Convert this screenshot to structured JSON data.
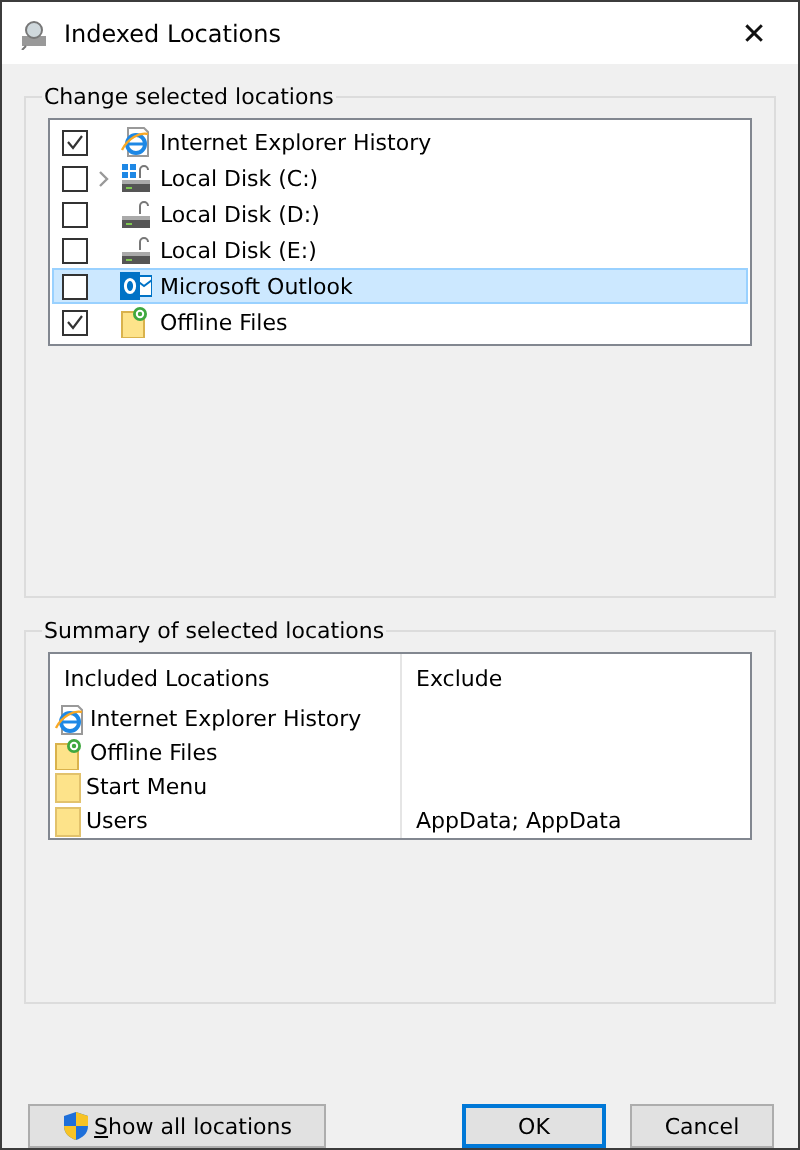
{
  "window": {
    "title": "Indexed Locations",
    "close": "✕"
  },
  "change_group": {
    "title": "Change selected locations",
    "items": [
      {
        "label": "Internet Explorer History",
        "kind": "ie",
        "checked": true,
        "expandable": false,
        "selected": false
      },
      {
        "label": "Local Disk (C:)",
        "kind": "system-disk",
        "checked": false,
        "expandable": true,
        "selected": false
      },
      {
        "label": "Local Disk (D:)",
        "kind": "disk",
        "checked": false,
        "expandable": false,
        "selected": false
      },
      {
        "label": "Local Disk (E:)",
        "kind": "disk",
        "checked": false,
        "expandable": false,
        "selected": false
      },
      {
        "label": "Microsoft Outlook",
        "kind": "outlook",
        "checked": false,
        "expandable": false,
        "selected": true
      },
      {
        "label": "Offline Files",
        "kind": "offline",
        "checked": true,
        "expandable": false,
        "selected": false
      }
    ]
  },
  "summary_group": {
    "title": "Summary of selected locations",
    "columns": [
      "Included Locations",
      "Exclude"
    ],
    "rows": [
      {
        "location": "Internet Explorer History",
        "kind": "ie",
        "exclude": ""
      },
      {
        "location": "Offline Files",
        "kind": "offline",
        "exclude": ""
      },
      {
        "location": "Start Menu",
        "kind": "folder",
        "exclude": ""
      },
      {
        "location": "Users",
        "kind": "folder",
        "exclude": "AppData; AppData"
      }
    ]
  },
  "buttons": [
    {
      "label": "Show all locations",
      "kind": "shield"
    },
    {
      "label": "OK",
      "kind": "default"
    },
    {
      "label": "Cancel",
      "kind": "plain"
    }
  ]
}
